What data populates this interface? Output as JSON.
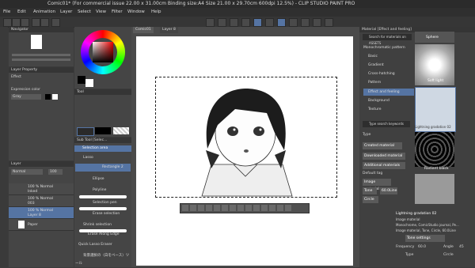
{
  "window": {
    "title": "Comic01* (For commercial issue 22.00 x 31.00cm Binding size:A4 Size 21.00 x 29.70cm 600dpi 12.5%) - CLIP STUDIO PAINT PRO"
  },
  "menu": [
    "File",
    "Edit",
    "Animation",
    "Layer",
    "Select",
    "View",
    "Filter",
    "Window",
    "Help"
  ],
  "navigator": {
    "title": "Navigator"
  },
  "layer_property": {
    "title": "Layer Property",
    "effect_label": "Effect",
    "expression_label": "Expression color",
    "expression_value": "Gray"
  },
  "layers": {
    "title": "Layer",
    "blend": "Normal",
    "opacity": "100",
    "rows": [
      {
        "pct": "100 % Normal",
        "name": "Inked"
      },
      {
        "pct": "100 % Normal",
        "name": "003"
      },
      {
        "pct": "100 % Normal",
        "name": "Layer 8"
      },
      {
        "pct": "",
        "name": "Paper"
      }
    ]
  },
  "tool": {
    "title": "Tool"
  },
  "subtool": {
    "title": "Sub Tool [Selec...",
    "header": "Selection area",
    "items": [
      "Lasso",
      "Rectangle 2",
      "Ellipse",
      "Polyline",
      "Selection pen",
      "Erase selection",
      "Shrink selection",
      "Erase Along Edge",
      "Quick Lasso Eraser",
      "背景選択の（白をベース）ツール"
    ]
  },
  "canvas_tabs": [
    "Comic01",
    "Layer 8"
  ],
  "material": {
    "title": "Material [Effect and feeling]",
    "search": "Search for materials on ASSETS",
    "tree": [
      "Monochromatic pattern",
      "Basic",
      "Gradient",
      "Cross-hatching",
      "Pattern",
      "Effect and feeling",
      "Background",
      "Texture"
    ],
    "search_keywords": "Type search keywords",
    "type_label": "Type",
    "type_buttons": [
      "Created material",
      "Downloaded material",
      "Additional materials"
    ],
    "default_tag_label": "Default tag",
    "tags": [
      "Image material",
      "Tone",
      "60.0Line",
      "Circle"
    ],
    "thumbs": [
      "Sphere",
      "Soft light",
      "Lightning gradation 02",
      "Radiant black"
    ],
    "detail": {
      "name": "Lightning gradation 02",
      "type": "Image material",
      "user_tag": "Monochrome, ComicStudio journal, Pe...",
      "default_tag": "Image material, Tone, Circle, 60.0Line",
      "tone_button": "Tone settings",
      "frequency_label": "Frequency",
      "frequency_value": "60.0",
      "angle_label": "Angle",
      "angle_value": "45",
      "type2": "Type",
      "circle": "Circle"
    }
  },
  "colors": {
    "accent": "#5574a3",
    "bg": "#3b3b3b"
  }
}
